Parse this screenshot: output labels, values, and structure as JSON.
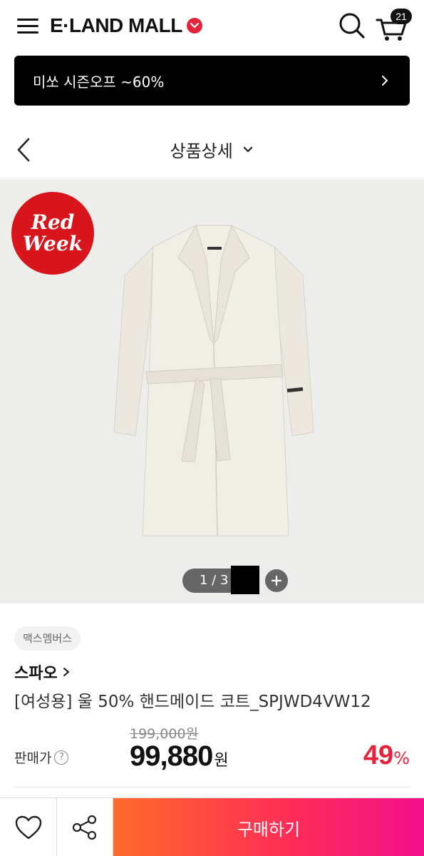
{
  "header": {
    "logo_text": "E·LAND MALL",
    "cart_count": "21"
  },
  "promo": {
    "text": "미쏘 시즌오프 ~60%"
  },
  "subheader": {
    "title": "상품상세"
  },
  "gallery": {
    "badge_line1": "Red",
    "badge_line2": "Week",
    "pager": "1 / 3"
  },
  "product": {
    "tag": "맥스멤버스",
    "brand": "스파오",
    "name": "[여성용] 울 50% 핸드메이드 코트_SPJWD4VW12",
    "original_price": "199,000원",
    "price_label": "판매가",
    "price": "99,880",
    "price_unit": "원",
    "discount": "49",
    "discount_unit": "%"
  },
  "bottom_bar": {
    "buy_label": "구매하기"
  },
  "colors": {
    "accent_red": "#e5243b",
    "buy_gradient_start": "#ff6a2b",
    "buy_gradient_end": "#f20f8c",
    "promo_bg": "#000000"
  },
  "icons": [
    "menu-icon",
    "logo-heart-icon",
    "search-icon",
    "cart-icon",
    "chevron-right-icon",
    "back-arrow-icon",
    "chevron-down-icon",
    "plus-icon",
    "question-icon",
    "heart-icon",
    "share-icon"
  ]
}
